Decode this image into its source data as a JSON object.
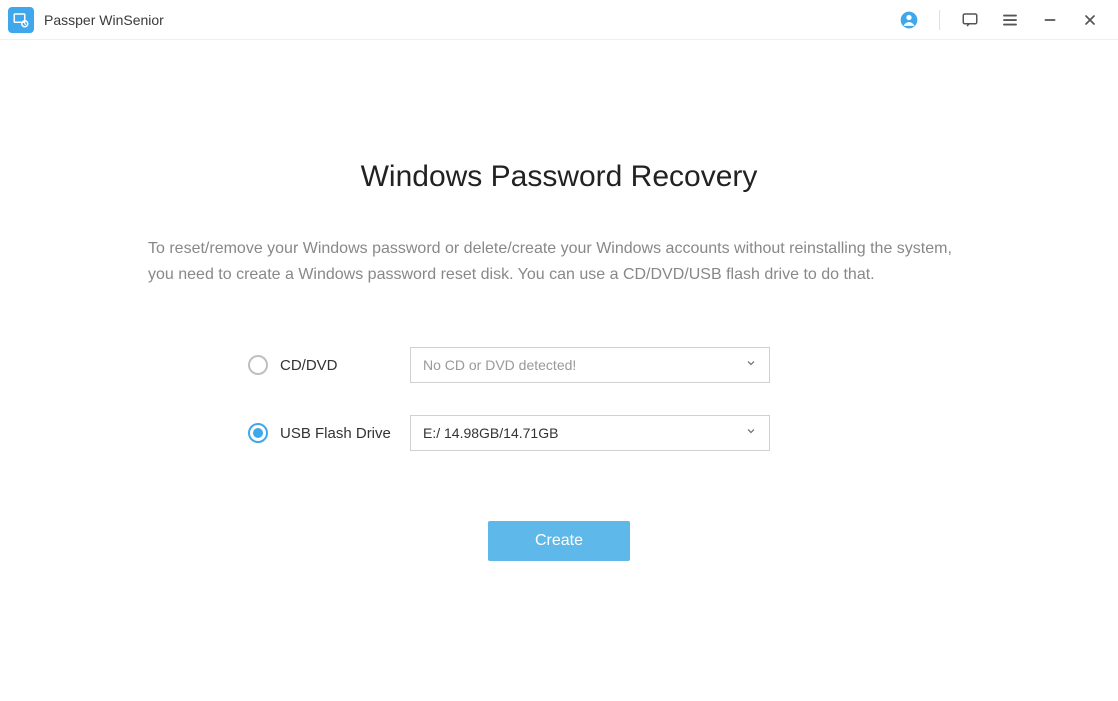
{
  "titlebar": {
    "app_title": "Passper WinSenior"
  },
  "main": {
    "heading": "Windows Password Recovery",
    "description": "To reset/remove your Windows password or delete/create your Windows accounts without reinstalling the system, you need to create a Windows password reset disk. You can use a CD/DVD/USB flash drive to do that.",
    "options": {
      "cddvd": {
        "label": "CD/DVD",
        "placeholder": "No CD or DVD detected!",
        "selected": false
      },
      "usb": {
        "label": "USB Flash Drive",
        "value": "E:/ 14.98GB/14.71GB",
        "selected": true
      }
    },
    "create_button": "Create"
  },
  "colors": {
    "accent": "#3fa7eb",
    "button": "#5fb8ea"
  }
}
